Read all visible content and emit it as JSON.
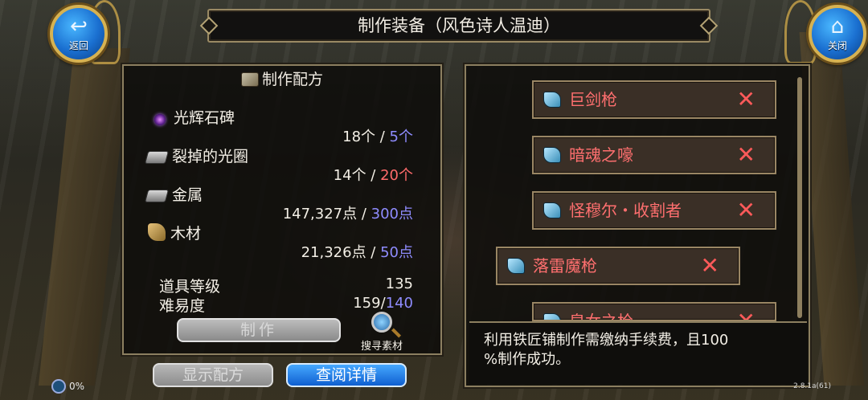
{
  "header": {
    "title": "制作装备（风色诗人温迪）",
    "back_label": "返回",
    "close_label": "关闭"
  },
  "recipe_panel": {
    "title": "制作配方",
    "materials": [
      {
        "name": "光辉石碑",
        "icon": "orb-icon",
        "have": "18个",
        "sep": " / ",
        "need": "5个",
        "need_color": "#8f8cff"
      },
      {
        "name": "裂掉的光圈",
        "icon": "ingot-icon",
        "have": "14个",
        "sep": " / ",
        "need": "20个",
        "need_color": "#ff6b6b"
      },
      {
        "name": "金属",
        "icon": "metal-icon",
        "have": "147,327点",
        "sep": " / ",
        "need": "300点",
        "need_color": "#8f8cff"
      },
      {
        "name": "木材",
        "icon": "wood-icon",
        "have": "21,326点",
        "sep": " / ",
        "need": "50点",
        "need_color": "#8f8cff"
      }
    ],
    "item_level_label": "道具等级",
    "item_level_value": "135",
    "difficulty_label": "难易度",
    "difficulty_current": "159/",
    "difficulty_max": "140",
    "craft_label": "制作",
    "search_label": "搜寻素材"
  },
  "bottom_buttons": {
    "show_recipe": "显示配方",
    "view_details": "查阅详情"
  },
  "weapon_list": [
    {
      "name": "巨剑枪"
    },
    {
      "name": "暗魂之嚎"
    },
    {
      "name": "怪穆尔・收割者"
    },
    {
      "name": "落雷魔枪"
    },
    {
      "name": "皇女之枪"
    }
  ],
  "info": {
    "text_line1": "利用铁匠铺制作需缴纳手续费，且100",
    "text_line2": "%制作成功。"
  },
  "status": {
    "percent": "0%",
    "version": "2.8.1a(61)"
  },
  "colors": {
    "gold_border": "#9a8664",
    "weapon_text": "#ff6f6f",
    "need_blue": "#8f8cff",
    "need_red": "#ff6b6b",
    "button_blue": "#1f7de0"
  }
}
